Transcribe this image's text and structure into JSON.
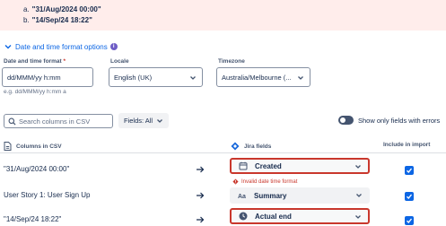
{
  "banner": {
    "items": [
      {
        "prefix": "a.",
        "text": "\"31/Aug/2024 00:00\""
      },
      {
        "prefix": "b.",
        "text": "\"14/Sep/24 18:22\""
      }
    ]
  },
  "section": {
    "toggle_label": "Date and time format options",
    "info_icon": "i"
  },
  "format_field": {
    "label": "Date and time format",
    "required_mark": "*",
    "value": "dd/MMM/yy h:mm",
    "helper": "e.g. dd/MMM/yy h:mm a"
  },
  "locale_field": {
    "label": "Locale",
    "value": "English (UK)"
  },
  "timezone_field": {
    "label": "Timezone",
    "value": "Australia/Melbourne (..."
  },
  "toolbar": {
    "search_placeholder": "Search columns in CSV",
    "fields_filter": "Fields: All",
    "toggle_label": "Show only fields with errors"
  },
  "table": {
    "headers": {
      "csv": "Columns in CSV",
      "jira": "Jira fields",
      "include": "Include in import"
    },
    "rows": [
      {
        "csv": "\"31/Aug/2024 00:00\"",
        "jira": "Created",
        "icon": "calendar-icon",
        "error": true,
        "included": true
      },
      {
        "csv": "User Story 1: User Sign Up",
        "jira": "Summary",
        "icon": "text-icon",
        "error": false,
        "included": true
      },
      {
        "csv": "\"14/Sep/24 18:22\"",
        "jira": "Actual end",
        "icon": "clock-icon",
        "error": true,
        "included": true
      }
    ],
    "error_message": "Invalid date time format"
  },
  "colors": {
    "error": "#c9372c",
    "link": "#0c66e4",
    "banner_bg": "#ffedeb"
  }
}
